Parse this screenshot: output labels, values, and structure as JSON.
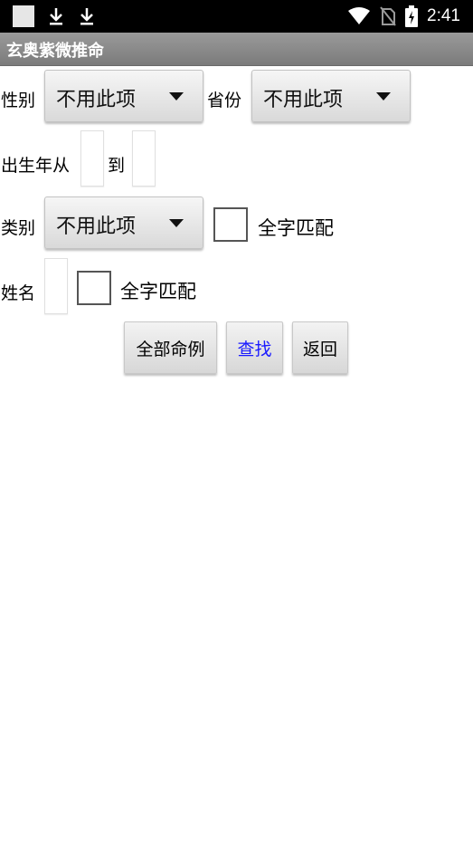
{
  "status_bar": {
    "time": "2:41",
    "icons": [
      "square-notification-icon",
      "download-icon",
      "download-icon",
      "wifi-icon",
      "no-sim-icon",
      "battery-charging-icon"
    ]
  },
  "title": "玄奥紫微推命",
  "form": {
    "gender_label": "性别",
    "gender_value": "不用此项",
    "province_label": "省份",
    "province_value": "不用此项",
    "birth_year_from_label": "出生年从",
    "birth_year_to_label": "到",
    "category_label": "类别",
    "category_value": "不用此项",
    "category_fullmatch_label": "全字匹配",
    "name_label": "姓名",
    "name_fullmatch_label": "全字匹配"
  },
  "buttons": {
    "all_cases": "全部命例",
    "search": "查找",
    "back": "返回"
  },
  "colors": {
    "search_text": "#1a1aff",
    "title_bar": "#8a8a8a"
  }
}
